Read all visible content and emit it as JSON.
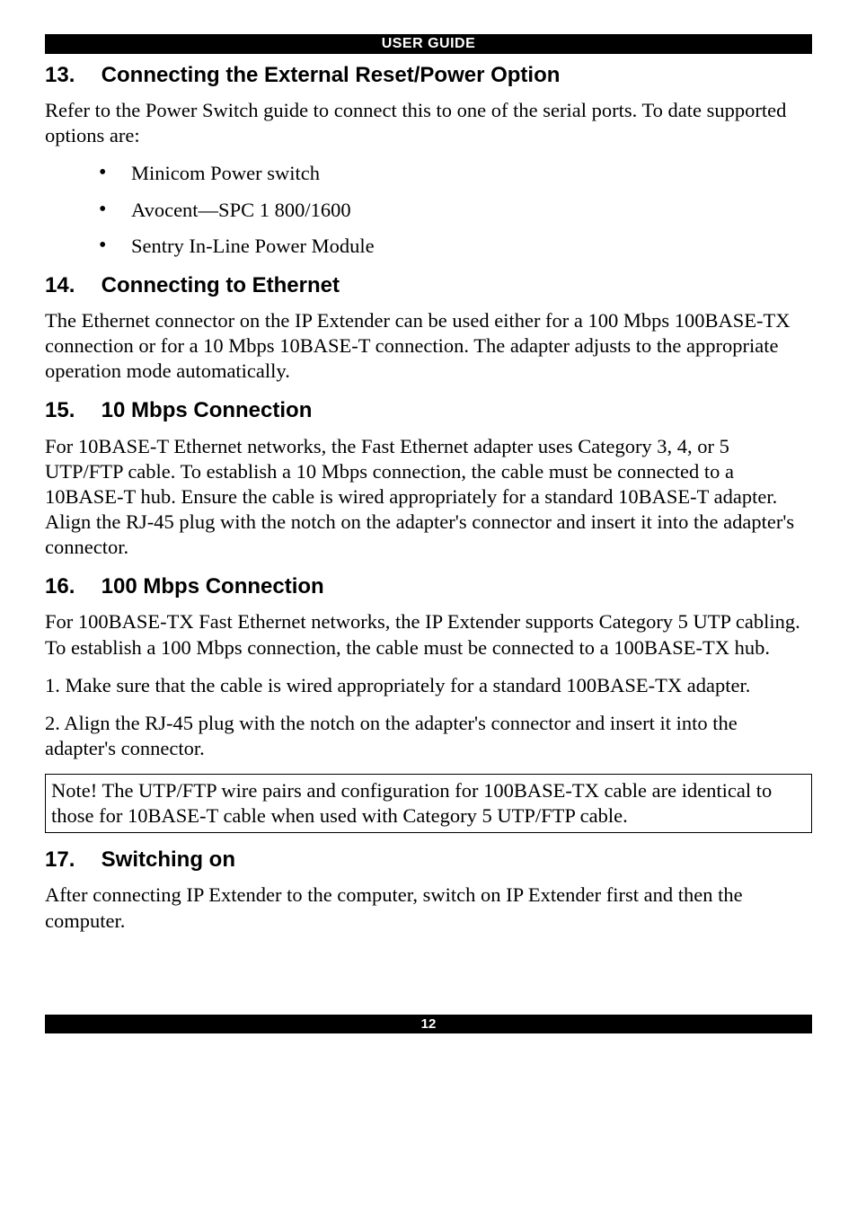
{
  "header": {
    "title": "USER GUIDE"
  },
  "sections": {
    "s13": {
      "number": "13.",
      "title": "Connecting the External Reset/Power Option",
      "intro": "Refer to the Power Switch guide to connect this to one of the serial ports. To date supported options are:",
      "bullets": [
        "Minicom Power switch",
        "Avocent—SPC 1 800/1600",
        "Sentry In-Line Power Module"
      ]
    },
    "s14": {
      "number": "14.",
      "title": "Connecting to Ethernet",
      "body": "The Ethernet connector on the IP Extender can be used either for a 100 Mbps 100BASE-TX connection or for a 10 Mbps 10BASE-T connection. The adapter adjusts to the appropriate operation mode automatically."
    },
    "s15": {
      "number": "15.",
      "title": "10 Mbps Connection",
      "body": "For 10BASE-T Ethernet networks, the Fast Ethernet adapter uses Category 3, 4, or 5 UTP/FTP cable. To establish a 10 Mbps connection, the cable must be connected to a 10BASE-T hub. Ensure the cable is wired appropriately for a standard 10BASE-T adapter. Align the RJ-45 plug with the notch on the adapter's connector and insert it into the adapter's connector."
    },
    "s16": {
      "number": "16.",
      "title": "100 Mbps Connection",
      "body": "For 100BASE-TX Fast Ethernet networks, the IP Extender supports Category 5 UTP cabling. To establish a 100 Mbps connection, the cable must be connected to a 100BASE-TX hub.",
      "step1": "1. Make sure that the cable is wired appropriately for a standard 100BASE-TX adapter.",
      "step2": "2. Align the RJ-45 plug with the notch on the adapter's connector and insert it into the adapter's connector.",
      "note": "Note! The UTP/FTP wire pairs and configuration for 100BASE-TX cable are identical to those for 10BASE-T cable when used with Category 5 UTP/FTP cable."
    },
    "s17": {
      "number": "17.",
      "title": "Switching on",
      "body": "After connecting IP Extender to the computer, switch on IP Extender first and then the computer."
    }
  },
  "footer": {
    "page_number": "12"
  }
}
